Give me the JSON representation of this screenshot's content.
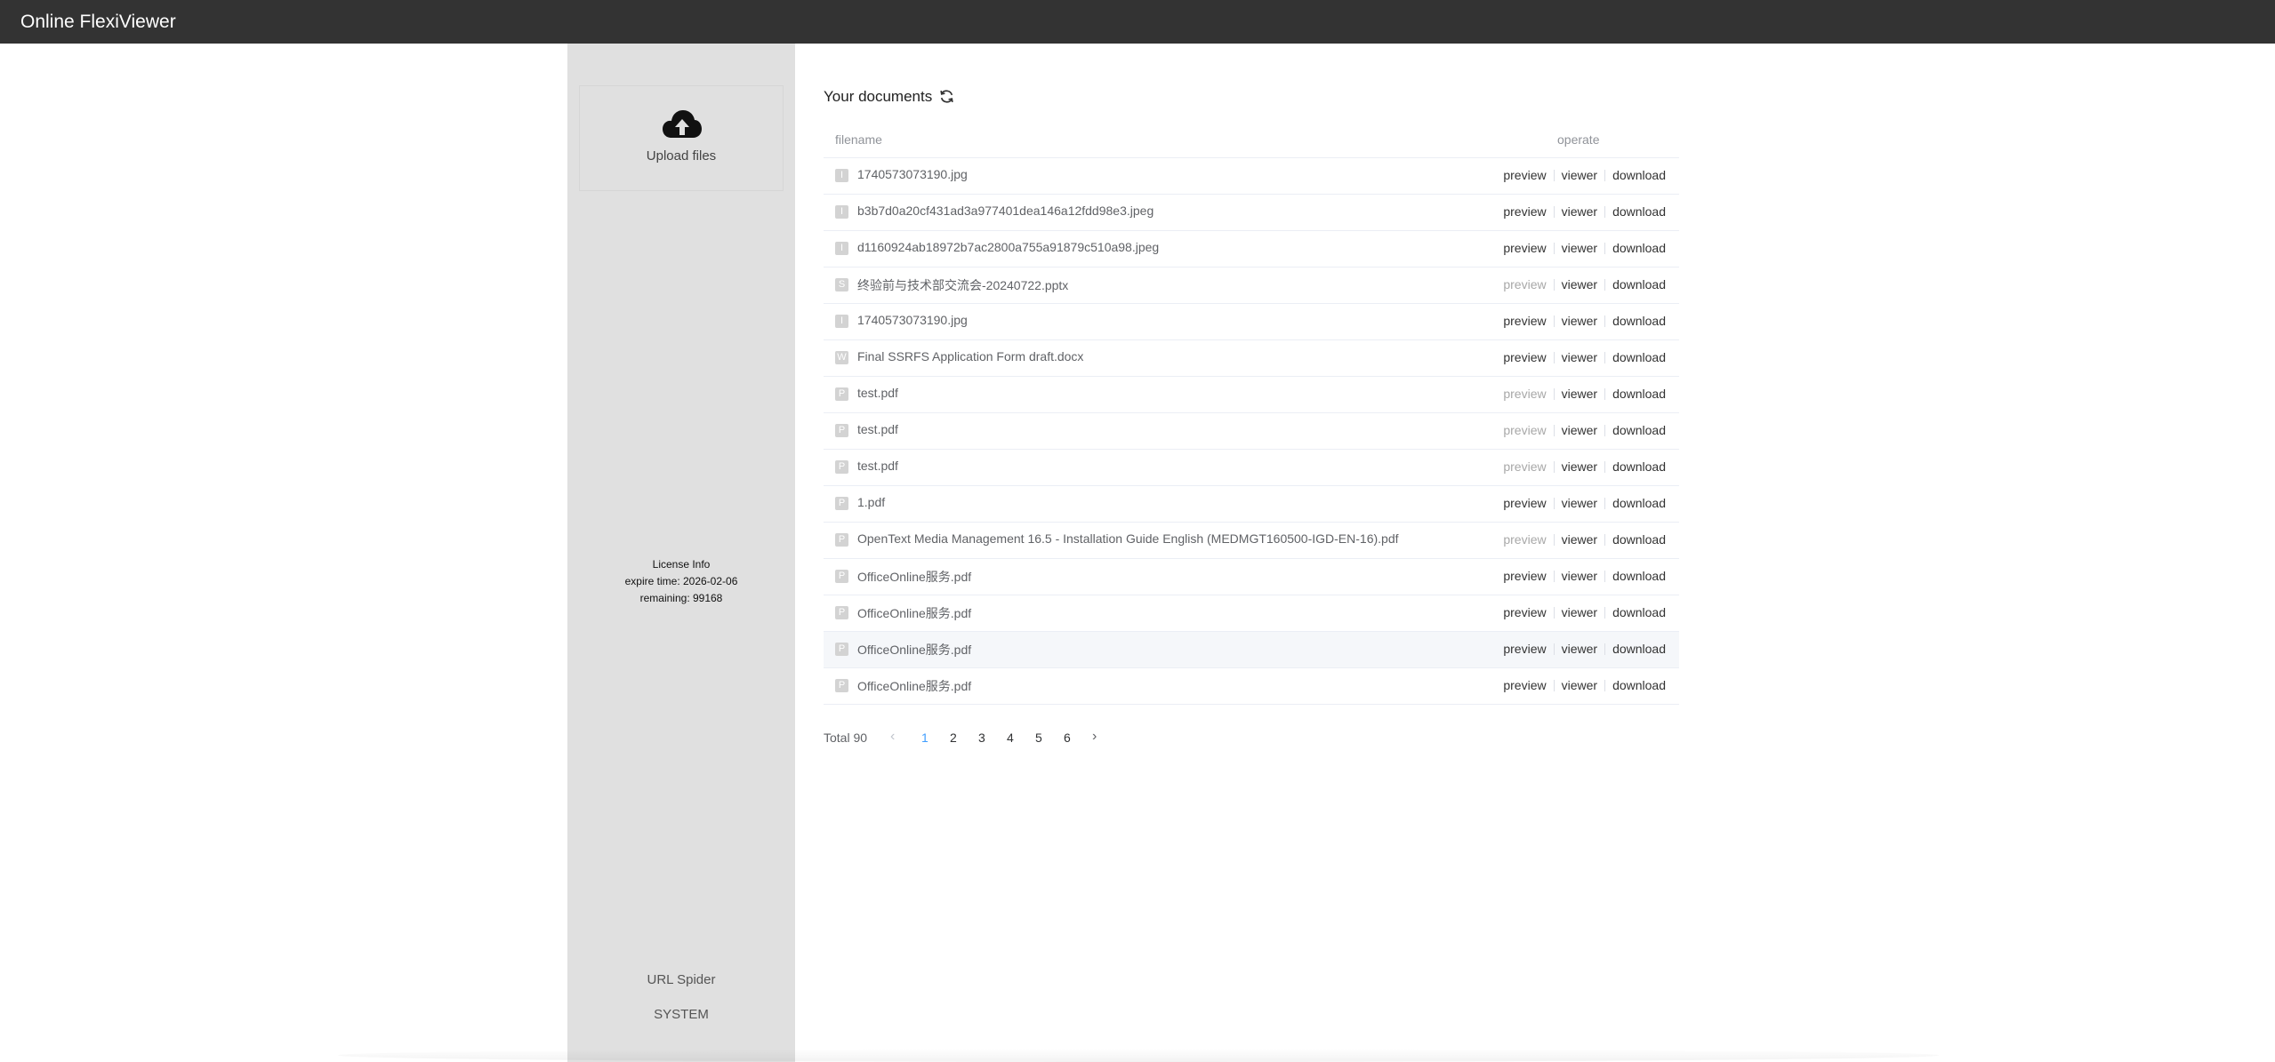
{
  "header": {
    "title": "Online FlexiViewer"
  },
  "sidebar": {
    "upload_label": "Upload files",
    "license": {
      "title": "License Info",
      "expire": "expire time: 2026-02-06",
      "remaining": "remaining: 99168"
    },
    "links": [
      "URL Spider",
      "SYSTEM"
    ]
  },
  "main": {
    "title": "Your documents",
    "table": {
      "headers": {
        "filename": "filename",
        "operate": "operate"
      },
      "ops": {
        "preview": "preview",
        "viewer": "viewer",
        "download": "download"
      },
      "rows": [
        {
          "icon": "I",
          "name": "1740573073190.jpg",
          "preview_enabled": true
        },
        {
          "icon": "I",
          "name": "b3b7d0a20cf431ad3a977401dea146a12fdd98e3.jpeg",
          "preview_enabled": true
        },
        {
          "icon": "I",
          "name": "d1160924ab18972b7ac2800a755a91879c510a98.jpeg",
          "preview_enabled": true
        },
        {
          "icon": "S",
          "name": "终验前与技术部交流会-20240722.pptx",
          "preview_enabled": false
        },
        {
          "icon": "I",
          "name": "1740573073190.jpg",
          "preview_enabled": true
        },
        {
          "icon": "W",
          "name": "Final SSRFS Application Form draft.docx",
          "preview_enabled": true
        },
        {
          "icon": "P",
          "name": "test.pdf",
          "preview_enabled": false
        },
        {
          "icon": "P",
          "name": "test.pdf",
          "preview_enabled": false
        },
        {
          "icon": "P",
          "name": "test.pdf",
          "preview_enabled": false
        },
        {
          "icon": "P",
          "name": "1.pdf",
          "preview_enabled": true
        },
        {
          "icon": "P",
          "name": "OpenText Media Management 16.5 - Installation Guide English (MEDMGT160500-IGD-EN-16).pdf",
          "preview_enabled": false
        },
        {
          "icon": "P",
          "name": "OfficeOnline服务.pdf",
          "preview_enabled": true
        },
        {
          "icon": "P",
          "name": "OfficeOnline服务.pdf",
          "preview_enabled": true
        },
        {
          "icon": "P",
          "name": "OfficeOnline服务.pdf",
          "preview_enabled": true
        },
        {
          "icon": "P",
          "name": "OfficeOnline服务.pdf",
          "preview_enabled": true
        }
      ],
      "hovered_row": 13
    },
    "pagination": {
      "total": "Total 90",
      "pages": [
        "1",
        "2",
        "3",
        "4",
        "5",
        "6"
      ],
      "current": "1",
      "prev": "‹",
      "next": "›"
    }
  },
  "colors": {
    "topbar": "#333333",
    "sidebar": "#e0e0e0",
    "accent": "#409eff"
  }
}
